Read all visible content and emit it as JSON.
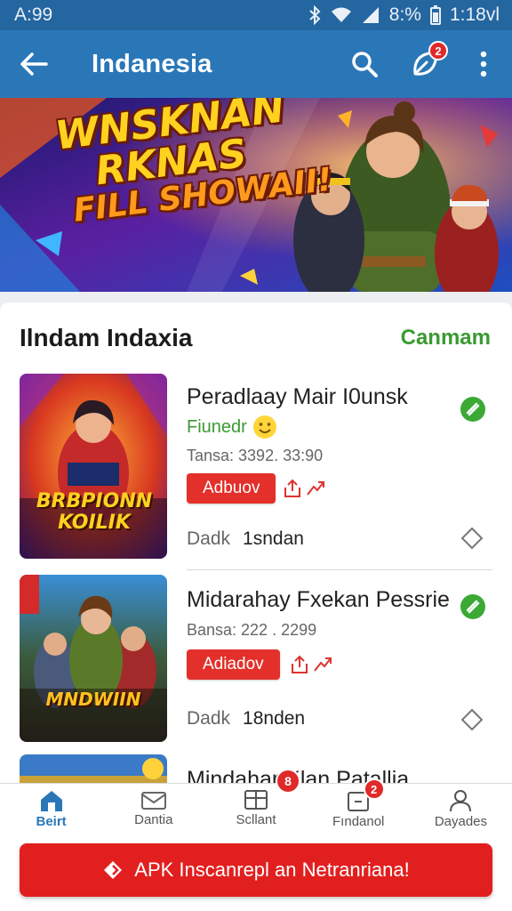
{
  "status_bar": {
    "left": "A:99",
    "battery": "8:%",
    "time": "1:18vl"
  },
  "app_bar": {
    "title": "Indanesia",
    "notification_count": "2"
  },
  "banner": {
    "line1": "WNSKNAN",
    "line2": "RKNAS",
    "line3": "FILL SHOWAII!"
  },
  "section": {
    "title": "Ilndam Indaxia",
    "link": "Canmam"
  },
  "games": [
    {
      "thumb_text": "BRBPIONN KOILIK",
      "title": "Peradlaay Mair I0unsk",
      "subtitle": "Fiunedr",
      "meta": "Tansa:  3392. 33:90",
      "button": "Adbuov",
      "status_label": "Dadk",
      "status_value": "1sndan"
    },
    {
      "thumb_text": "MNDWIIN",
      "title": "Midarahay Fxekan Pessrie",
      "meta": "Bansa:  222 . 2299",
      "button": "Adiadov",
      "status_label": "Dadk",
      "status_value": "18nden"
    },
    {
      "title": "Mindahar  Klan Patallia"
    }
  ],
  "bottom_nav": [
    {
      "label": "Beirt",
      "icon": "home-icon",
      "active": true
    },
    {
      "label": "Dantia",
      "icon": "mail-icon"
    },
    {
      "label": "Scllant",
      "icon": "grid-icon"
    },
    {
      "label": "Fındanol",
      "icon": "inbox-icon",
      "badge": "2"
    },
    {
      "label": "Dayades",
      "icon": "person-icon"
    }
  ],
  "overlay_badge": "8",
  "cta": {
    "label": "APK Inscanrepl an Netranriana!"
  },
  "colors": {
    "status_bar": "#2466a0",
    "app_bar": "#2a77b8",
    "accent_green": "#3a9a32",
    "button_red": "#e3302a",
    "cta_red": "#e21f1f"
  }
}
